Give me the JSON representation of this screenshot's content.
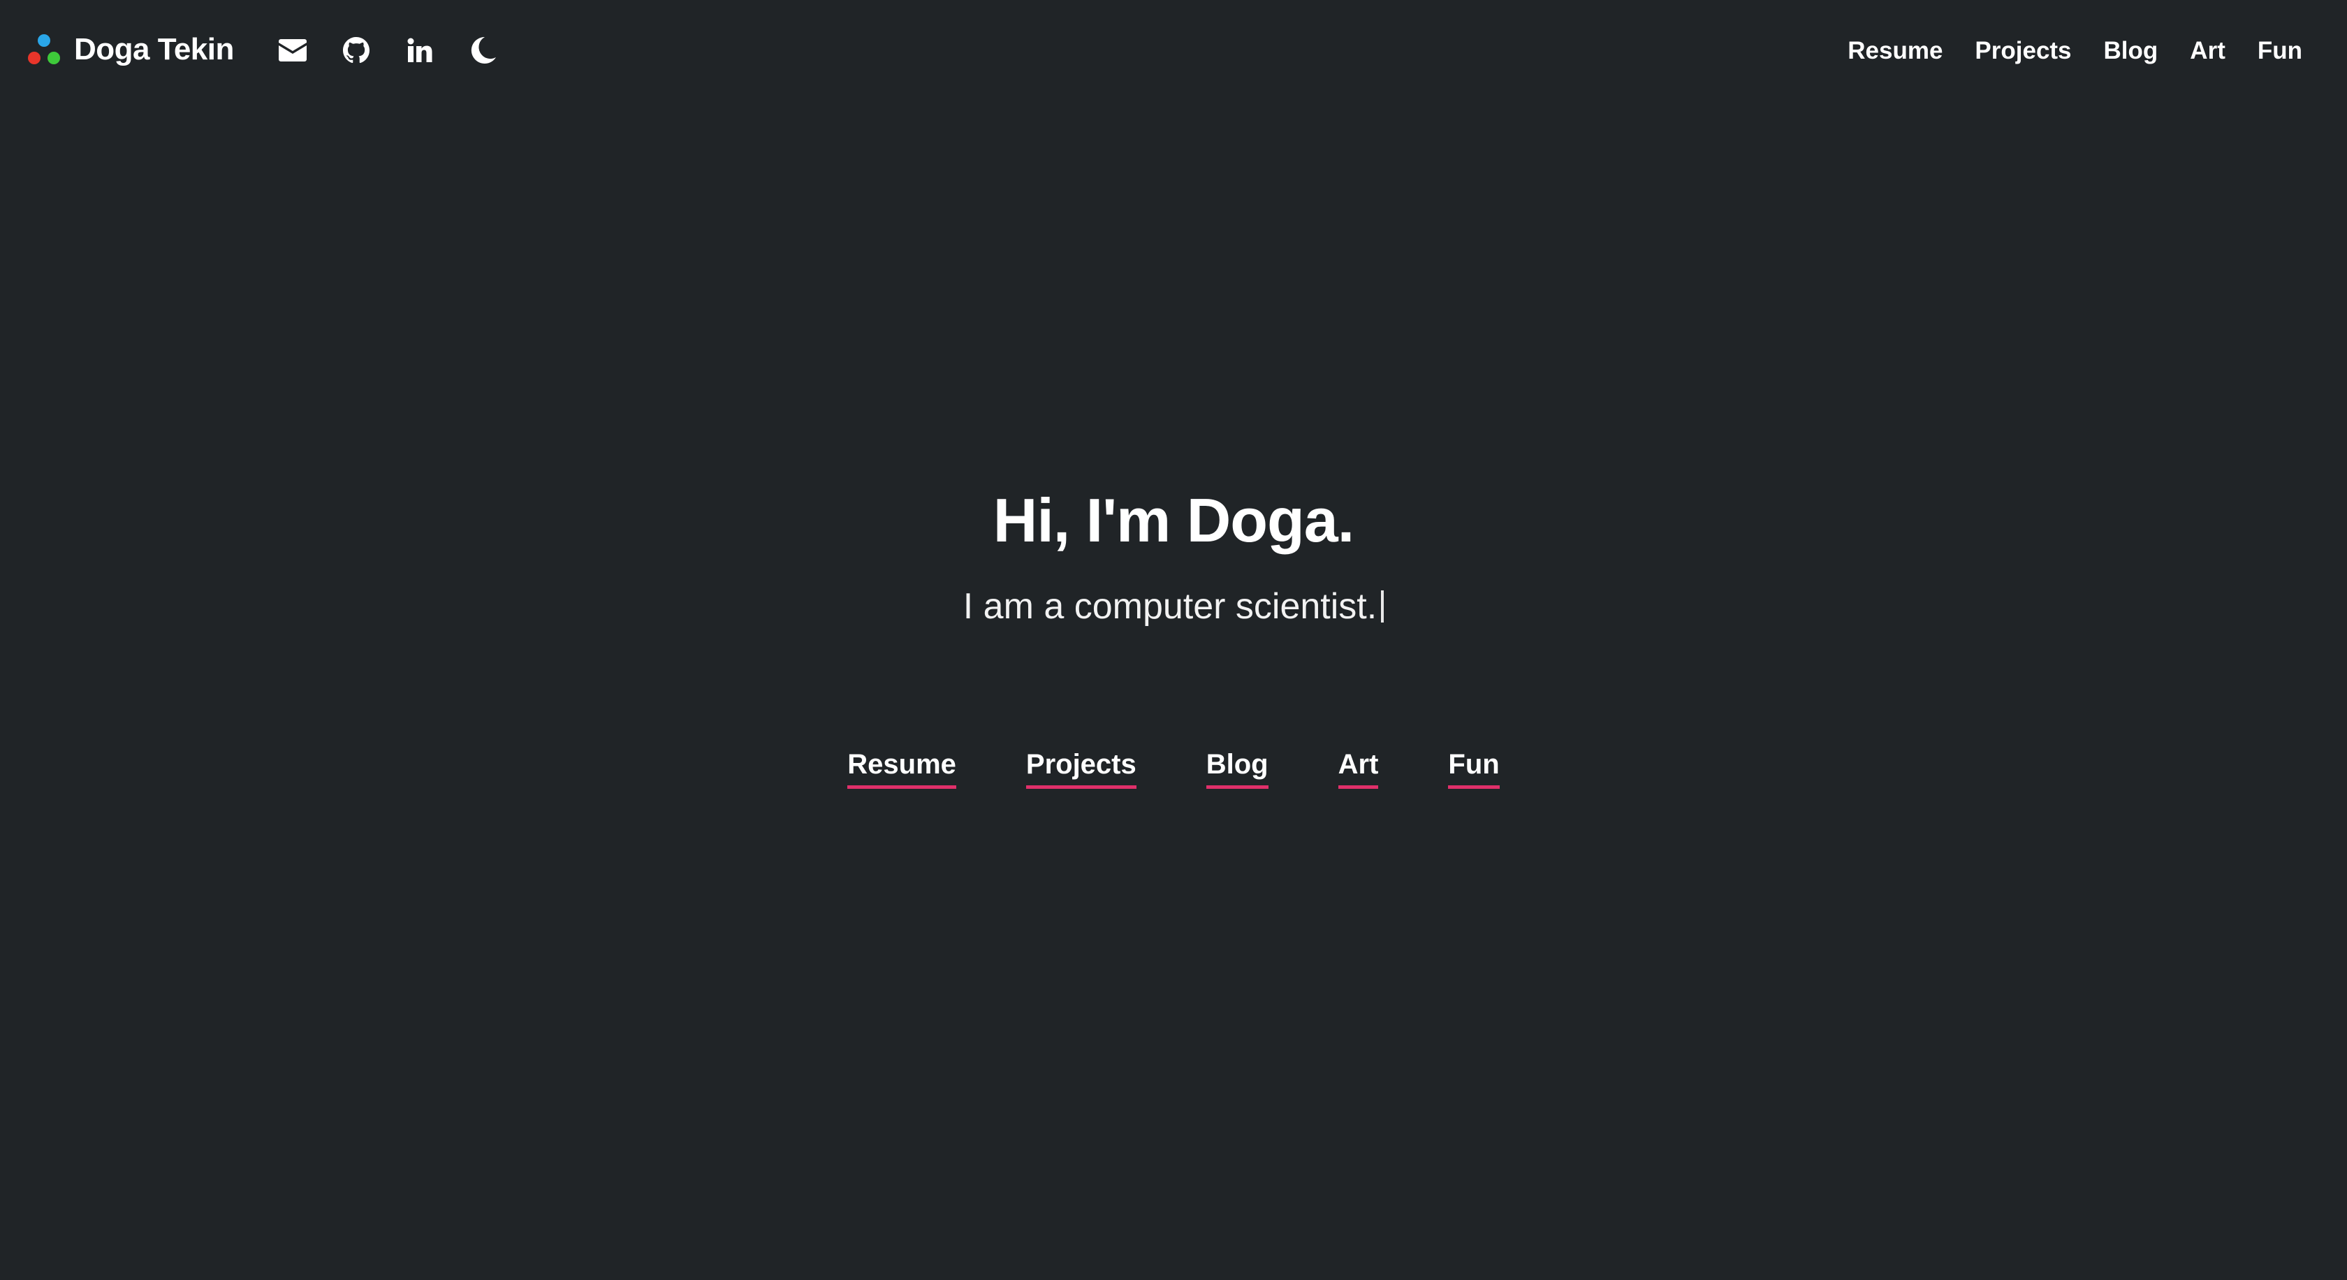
{
  "header": {
    "brand": {
      "name": "Doga Tekin",
      "logo_colors": [
        "#2aa6e8",
        "#e8352a",
        "#3ec93a"
      ]
    },
    "social": [
      {
        "icon": "envelope-icon"
      },
      {
        "icon": "github-icon"
      },
      {
        "icon": "linkedin-icon"
      },
      {
        "icon": "moon-icon"
      }
    ],
    "nav": [
      {
        "label": "Resume"
      },
      {
        "label": "Projects"
      },
      {
        "label": "Blog"
      },
      {
        "label": "Art"
      },
      {
        "label": "Fun"
      }
    ]
  },
  "hero": {
    "title": "Hi, I'm Doga.",
    "subtitle": "I am a computer scientist.",
    "links": [
      {
        "label": "Resume"
      },
      {
        "label": "Projects"
      },
      {
        "label": "Blog"
      },
      {
        "label": "Art"
      },
      {
        "label": "Fun"
      }
    ]
  },
  "colors": {
    "background": "#202427",
    "text": "#ffffff",
    "accent_underline": "#e0306a"
  }
}
